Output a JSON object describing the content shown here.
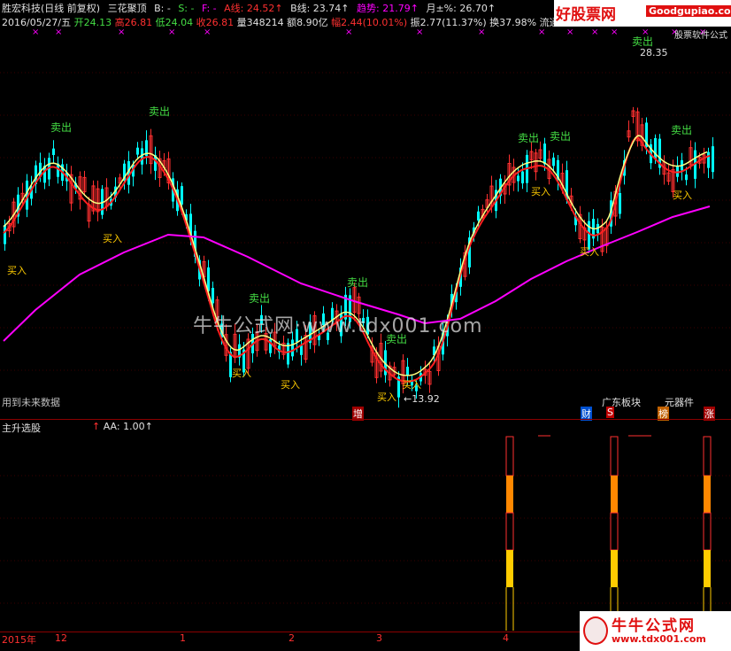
{
  "header": {
    "stock": "胜宏科技(日线 前复权)",
    "indicator": "三花聚顶",
    "b_label": "B: -",
    "s_label": "S: -",
    "f_label": "F: -",
    "a_line": "A线: 24.52↑",
    "b_line": "B线: 23.74↑",
    "trend": "趋势: 21.79↑",
    "month_pct": "月±%: 26.70↑",
    "date": "2016/05/27/五",
    "open": "开24.13",
    "high": "高26.81",
    "low": "低24.04",
    "close": "收26.81",
    "volume": "量348214",
    "amount": "额8.90亿",
    "change": "幅2.44(10.01%)",
    "amplitude": "振2.77(11.37%)",
    "turnover": "换37.98%",
    "float": "流通"
  },
  "brand": {
    "site_cn": "好股票网",
    "site_url": "Goodgupiao.com",
    "sub": "股票软件公式"
  },
  "annotations": {
    "sell": "卖出",
    "buy": "买入",
    "high_price": "28.35",
    "low_price": "←13.92",
    "future_data": "用到未来数据",
    "watermark": "牛牛公式网·www.tdx001.com"
  },
  "tags": {
    "zeng": "增",
    "cai": "财",
    "guangdong": "广东板块",
    "s": "S",
    "components": "元器件",
    "bang": "榜",
    "zhang": "涨"
  },
  "sub_panel": {
    "name": "主升选股",
    "aa": "AA: 1.00↑"
  },
  "x_axis": {
    "year": "2015年",
    "labels": [
      "12",
      "1",
      "2",
      "3",
      "4"
    ]
  },
  "bottom_brand": {
    "name": "牛牛公式网",
    "url": "www.tdx001.com"
  },
  "colors": {
    "up": "#ff3030",
    "down": "#00ffff",
    "a_line": "#ffff80",
    "b_line": "#ff2020",
    "trend_line": "#ff00ff",
    "sell_text": "#44dd44",
    "buy_text": "#ffcc00"
  }
}
